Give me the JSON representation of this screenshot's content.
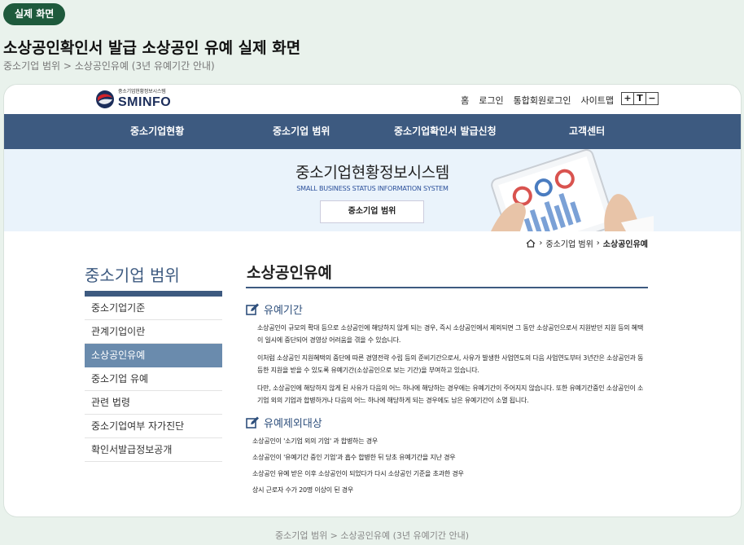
{
  "badge": "실제 화면",
  "heading": "소상공인확인서 발급 소상공인 유예 실제 화면",
  "breadcrumb": "중소기업 범위 > 소상공인유예 (3년 유예기간 안내)",
  "site": {
    "logo_small": "중소기업현황정보시스템",
    "logo_main": "SMINFO",
    "util": [
      "홈",
      "로그인",
      "통합회원로그인",
      "사이트맵"
    ],
    "font_buttons": [
      "+",
      "T",
      "−"
    ],
    "gnb": [
      "중소기업현황",
      "중소기업 범위",
      "중소기업확인서 발급신청",
      "고객센터"
    ],
    "hero_title": "중소기업현황정보시스템",
    "hero_sub": "SMALL BUSINESS STATUS INFORMATION SYSTEM",
    "hero_button": "중소기업 범위",
    "crumb": [
      "중소기업 범위",
      "소상공인유예"
    ]
  },
  "lnb": {
    "title": "중소기업 범위",
    "items": [
      "중소기업기준",
      "관계기업이란",
      "소상공인유예",
      "중소기업 유예",
      "관련 법령",
      "중소기업여부 자가진단",
      "확인서발급정보공개"
    ],
    "active_index": 2
  },
  "content": {
    "title": "소상공인유예",
    "sec1_title": "유예기간",
    "sec1_paras": [
      "소상공인이 규모의 확대 등으로 소상공인에 해당하지 않게 되는 경우, 즉시 소상공인에서 제외되면 그 동안 소상공인으로서 지원받던 지원 등의 혜택이 일시에 중단되어 경영상 어려움을 겪을 수 있습니다.",
      "이처럼 소상공인 지원혜택의 중단에 따른 경영전략 수립 등의 준비기간으로서, 사유가 발생한 사업연도의 다음 사업연도부터 3년간은 소상공인과 동등한 지원을 받을 수 있도록 유예기간(소상공인으로 보는 기간)을 부여하고 있습니다.",
      "다만, 소상공인에 해당하지 않게 된 사유가 다음의 어느 하나에 해당하는 경우에는 유예기간이 주어지지 않습니다. 또한 유예기간중인 소상공인이 소기업 외의 기업과 합병하거나 다음의 어느 하나에 해당하게 되는 경우에도 남은 유예기간이 소멸 됩니다."
    ],
    "sec2_title": "유예제외대상",
    "sec2_items": [
      "소상공인이 '소기업 외의 기업' 과 합병하는 경우",
      "소상공인이 '유예기간 중인 기업'과 흡수 합병한 뒤 당초 유예기간을 지난 경우",
      "소상공인 유예 받은 이후 소상공인이 되었다가 다시 소상공인 기준을 초과한 경우",
      "상시 근로자 수가 20명 이상이 된 경우"
    ]
  },
  "bottom_caption": "중소기업 범위 > 소상공인유예 (3년 유예기간 안내)"
}
